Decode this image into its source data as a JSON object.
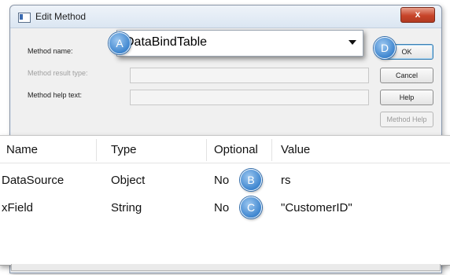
{
  "window": {
    "title": "Edit Method",
    "close_glyph": "x"
  },
  "form": {
    "method_name_label": "Method name:",
    "method_result_type_label": "Method result type:",
    "method_help_text_label": "Method help text:"
  },
  "combo": {
    "value": "DataBindTable",
    "arrow_icon": "chevron-down-icon"
  },
  "buttons": {
    "ok": "OK",
    "cancel": "Cancel",
    "help": "Help",
    "method_help": "Method Help"
  },
  "grid": {
    "headers": [
      "Name",
      "Type",
      "Optional",
      "Value"
    ],
    "rows": [
      {
        "name": "DataSource",
        "type": "Object",
        "optional": "No",
        "value": "rs"
      },
      {
        "name": "xField",
        "type": "String",
        "optional": "No",
        "value": "\"CustomerID\""
      }
    ]
  },
  "markers": {
    "a": "A",
    "b": "B",
    "c": "C",
    "d": "D"
  },
  "colors": {
    "marker": "#3f86cf",
    "close": "#c7442a",
    "ok_focus": "#3c7fb1"
  }
}
